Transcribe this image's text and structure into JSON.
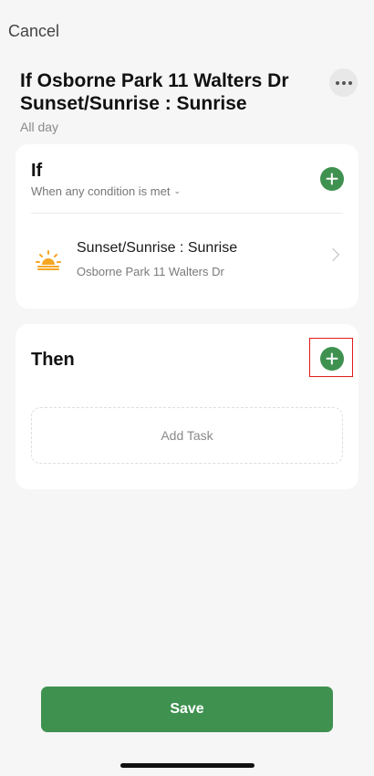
{
  "header": {
    "cancel_label": "Cancel",
    "title": "If Osborne Park 11 Walters Dr Sunset/Sunrise : Sunrise",
    "subtitle": "All day"
  },
  "if_section": {
    "title": "If",
    "condition_mode": "When any condition is met",
    "conditions": [
      {
        "icon": "sunrise-icon",
        "title": "Sunset/Sunrise : Sunrise",
        "subtitle": "Osborne Park 11 Walters Dr"
      }
    ]
  },
  "then_section": {
    "title": "Then",
    "add_task_label": "Add Task"
  },
  "footer": {
    "save_label": "Save"
  },
  "colors": {
    "accent_green": "#3f9150",
    "sun_orange": "#f5a623",
    "highlight_red": "#e01b1b"
  }
}
